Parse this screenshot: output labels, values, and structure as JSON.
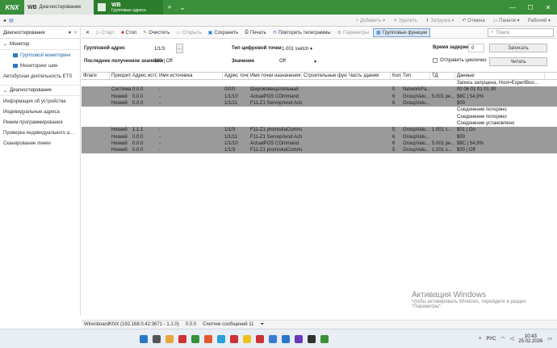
{
  "titlebar": {
    "logo": "KNX",
    "tab1_label": "WB",
    "tab1_sub": "Диагностирование",
    "tab2_title": "WB",
    "tab2_sub": "Групповые адреса"
  },
  "ribbon": {
    "add": "Добавить",
    "delete": "Удалить",
    "download": "Загрузка",
    "undo": "Отмена",
    "panels": "Панели",
    "workspace": "Рабочий ▾"
  },
  "sidebar": {
    "header": "Диагностирование",
    "sections": [
      {
        "title": "Монитор",
        "items": [
          "Групповой мониторинг",
          "Мониторинг шин",
          "Автобусная деятельность ETS"
        ]
      },
      {
        "title": "Диагностирование",
        "items": [
          "Информация об устройстве",
          "Индивидуальные адреса",
          "Режим программирования",
          "Проверка индивидуального а...",
          "Сканирование линии"
        ]
      }
    ]
  },
  "toolbar": {
    "start": "Старт",
    "stop": "Стоп",
    "clear": "Очистить",
    "open": "Открыть",
    "save": "Сохранить",
    "print": "Печать",
    "repeat": "Повторить телеграммы",
    "params": "Параметры",
    "group_func": "Групповые функции",
    "search_placeholder": "Поиск"
  },
  "form": {
    "group_addr_label": "Групповой адрес",
    "group_addr_value": "1/1/3",
    "dpt_label": "Тип цифровой точки",
    "dpt_value": "1.001 switch",
    "delay_label": "Время задержки[сек]",
    "delay_value": "0",
    "write_btn": "Записать",
    "last_value_label": "Последнее полученное значение",
    "last_value": "$00 | Off",
    "value_label": "Значение",
    "value_select": "Off",
    "cyclic_label": "Отправить циклично",
    "read_btn": "Читать"
  },
  "table": {
    "headers": [
      "Флаги",
      "Приорите",
      "Адрес исто",
      "Имя источника",
      "Адрес точк",
      "Имя точки назначения",
      "Строительные функ",
      "Часть здания",
      "Колі",
      "Тип",
      "ТД",
      "Данные"
    ],
    "rows": [
      {
        "g": false,
        "c": [
          "",
          "",
          "",
          "",
          "",
          "",
          "",
          "",
          "",
          "",
          "",
          "Запись запущена, Host=ExpertBoo..."
        ]
      },
      {
        "g": true,
        "c": [
          "",
          "Система",
          "0.0.0",
          "-",
          "0/0/0",
          "Широковещательный",
          "",
          "",
          "0",
          "NetworkPa...",
          "",
          "00 06 01 01 01 00"
        ]
      },
      {
        "g": true,
        "c": [
          "",
          "Низкий",
          "0.0.0",
          "-",
          "1/1/10",
          "ActualPOS COmmand",
          "",
          "",
          "6",
          "GroupValu...",
          "5.001 pe...",
          "$8C | 54,9%"
        ]
      },
      {
        "g": true,
        "c": [
          "",
          "Низкий",
          "0.0.0",
          "-",
          "1/1/11",
          "F11-Z1 Servoprivod ActualPos",
          "",
          "",
          "6",
          "GroupValu...",
          "",
          "$00"
        ]
      },
      {
        "g": false,
        "c": [
          "",
          "",
          "",
          "",
          "",
          "",
          "",
          "",
          "",
          "",
          "",
          "Соединение потеряно"
        ]
      },
      {
        "g": false,
        "c": [
          "",
          "",
          "",
          "",
          "",
          "",
          "",
          "",
          "",
          "",
          "",
          "Соединение потеряно"
        ]
      },
      {
        "g": false,
        "c": [
          "",
          "",
          "",
          "",
          "",
          "",
          "",
          "",
          "",
          "",
          "",
          "Соединение установлено"
        ]
      },
      {
        "g": true,
        "c": [
          "",
          "Низкий",
          "1.1.1",
          "-",
          "1/1/3",
          "F11-Z1 promivkaCommand",
          "",
          "",
          "5",
          "GroupValu...",
          "1.001 s...",
          "$01 | On"
        ]
      },
      {
        "g": true,
        "c": [
          "",
          "Низкий",
          "0.0.0",
          "-",
          "1/1/11",
          "F11-Z1 Servoprivod ActualPos",
          "",
          "",
          "6",
          "GroupValu...",
          "",
          "$00"
        ]
      },
      {
        "g": true,
        "c": [
          "",
          "Низкий",
          "0.0.0",
          "-",
          "1/1/10",
          "ActualPOS COmmand",
          "",
          "",
          "6",
          "GroupValu...",
          "5.001 pe...",
          "$8C | 54,9%"
        ]
      },
      {
        "g": true,
        "c": [
          "",
          "Низкий",
          "0.0.0",
          "-",
          "1/1/3",
          "F11-Z1 promivkaCommand",
          "",
          "",
          "5",
          "GroupValu...",
          "1.001 s...",
          "$00 | Off"
        ]
      }
    ]
  },
  "status": {
    "conn": "WirenboardKNX (192.168.0.42:3671 - 1.1.0)",
    "addr": "0.0.0",
    "counter": "Счетчик сообщений 11"
  },
  "watermark": {
    "line1": "Активация Windows",
    "line2": "Чтобы активировать Windows, перейдите в раздел",
    "line3": "\"Параметры\"."
  },
  "taskbar": {
    "lang": "РУС",
    "time": "10:43",
    "date": "25.02.2026"
  },
  "colors": {
    "accent": "#3a8f3a",
    "grey_row": "#9a9a9a",
    "link": "#1a5fa8"
  }
}
